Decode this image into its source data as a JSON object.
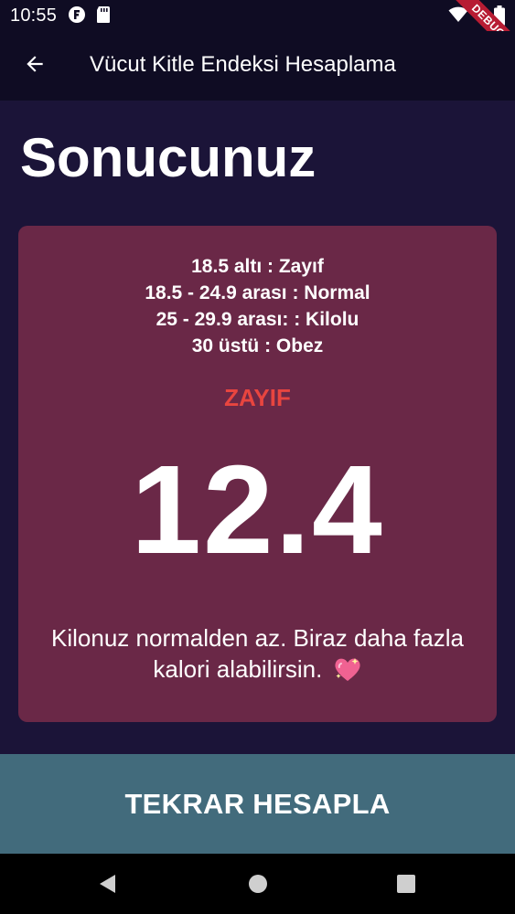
{
  "status_bar": {
    "time": "10:55",
    "debug_label": "DEBUG"
  },
  "app_bar": {
    "title": "Vücut Kitle Endeksi Hesaplama"
  },
  "page": {
    "title": "Sonucunuz"
  },
  "result": {
    "ranges": [
      "18.5 altı : Zayıf",
      "18.5 - 24.9 arası : Normal",
      "25 - 29.9 arası: : Kilolu",
      "30 üstü : Obez"
    ],
    "category": "ZAYIF",
    "bmi": "12.4",
    "advice": "Kilonuz normalden az. Biraz daha fazla kalori alabilirsin."
  },
  "actions": {
    "recalculate_label": "TEKRAR HESAPLA"
  },
  "colors": {
    "background": "#1b1438",
    "app_bar": "#0f0c23",
    "card": "#6a2847",
    "category": "#e8453f",
    "button": "#426b7c"
  },
  "icons": {
    "back": "arrow-back-icon",
    "heart": "sparkling-heart-icon",
    "wifi": "wifi-icon",
    "battery": "battery-icon",
    "nav_back": "triangle-back-icon",
    "nav_home": "circle-home-icon",
    "nav_recents": "square-recents-icon"
  }
}
